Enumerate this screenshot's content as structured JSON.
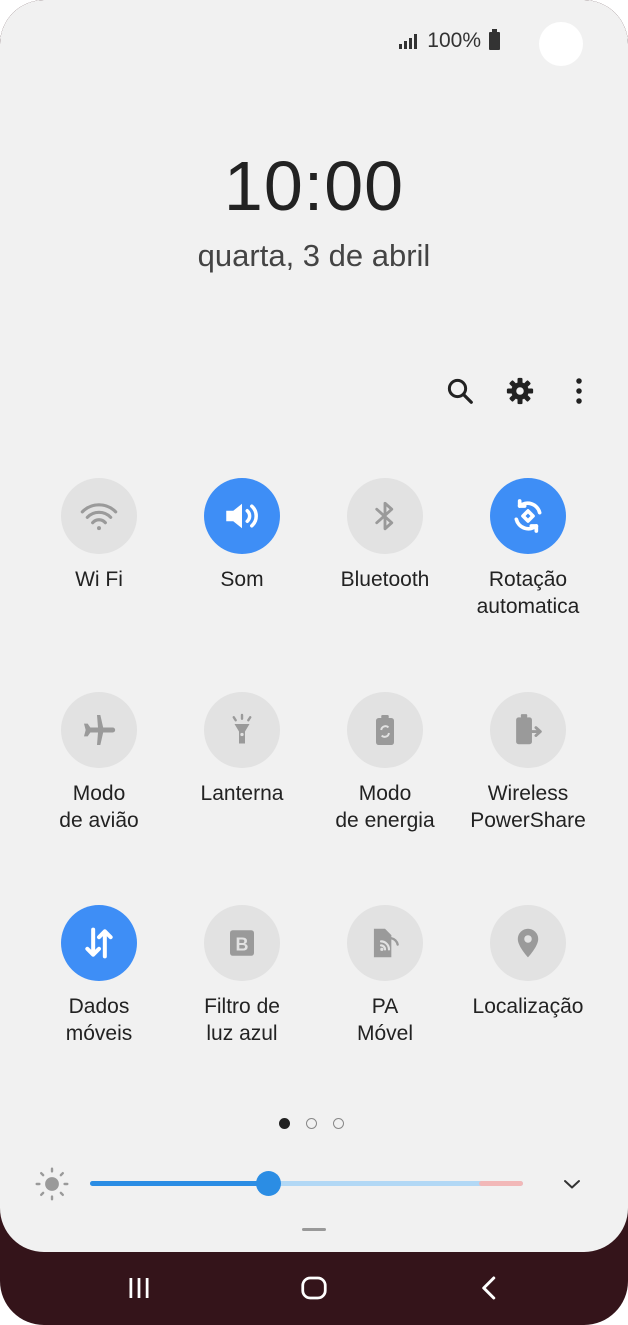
{
  "status_bar": {
    "battery_text": "100%"
  },
  "lock": {
    "time": "10:00",
    "date": "quarta, 3 de abril"
  },
  "toolbar": {
    "icons": [
      "search-icon",
      "gear-icon",
      "more-vert-icon"
    ]
  },
  "tiles": [
    {
      "label": "Wi Fi",
      "icon": "wifi-icon",
      "active": false
    },
    {
      "label": "Som",
      "icon": "volume-icon",
      "active": true
    },
    {
      "label": "Bluetooth",
      "icon": "bluetooth-icon",
      "active": false
    },
    {
      "label": "Rotação\nautomatica",
      "icon": "auto-rotate-icon",
      "active": true
    },
    {
      "label": "Modo\nde avião",
      "icon": "airplane-icon",
      "active": false
    },
    {
      "label": "Lanterna",
      "icon": "flashlight-icon",
      "active": false
    },
    {
      "label": "Modo\nde energia",
      "icon": "power-mode-icon",
      "active": false
    },
    {
      "label": "Wireless\nPowerShare",
      "icon": "wireless-powershare-icon",
      "active": false
    },
    {
      "label": "Dados\nmóveis",
      "icon": "mobile-data-icon",
      "active": true
    },
    {
      "label": "Filtro de\nluz azul",
      "icon": "blue-light-filter-icon",
      "active": false
    },
    {
      "label": "PA\nMóvel",
      "icon": "mobile-hotspot-icon",
      "active": false
    },
    {
      "label": "Localização",
      "icon": "location-icon",
      "active": false
    }
  ],
  "page_indicator": {
    "pages": 3,
    "current": 1
  },
  "brightness": {
    "level_percent": 41
  },
  "colors": {
    "active_tile": "#3e8ef6",
    "inactive_tile": "#e2e2e2",
    "slider": "#2b8de4",
    "nav_bar": "#34141a"
  },
  "nav_bar": {
    "buttons": [
      "recents-icon",
      "home-icon",
      "back-icon"
    ]
  }
}
